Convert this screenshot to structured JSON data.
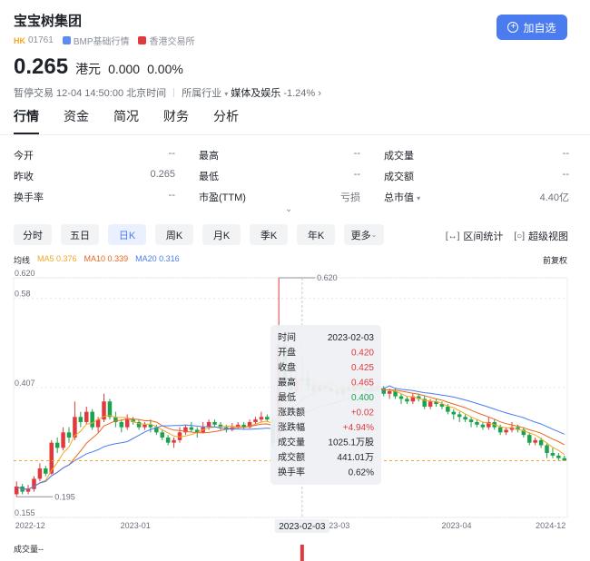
{
  "header": {
    "title": "宝宝树集团",
    "market": "HK",
    "code": "01761",
    "bmp": "BMP基础行情",
    "exchange": "香港交易所",
    "follow_label": "加自选"
  },
  "quote": {
    "price": "0.265",
    "unit": "港元",
    "change": "0.000",
    "change_pct": "0.00%",
    "status": "暂停交易 12-04 14:50:00 北京时间",
    "industry_prefix": "所属行业",
    "industry": "媒体及娱乐",
    "industry_chg": "-1.24%"
  },
  "tabs": [
    "行情",
    "资金",
    "简况",
    "财务",
    "分析"
  ],
  "stats": [
    [
      {
        "label": "今开",
        "value": "--"
      },
      {
        "label": "最高",
        "value": "--"
      },
      {
        "label": "成交量",
        "value": "--"
      }
    ],
    [
      {
        "label": "昨收",
        "value": "0.265"
      },
      {
        "label": "最低",
        "value": "--"
      },
      {
        "label": "成交额",
        "value": "--"
      }
    ],
    [
      {
        "label": "换手率",
        "value": "--"
      },
      {
        "label": "市盈(TTM)",
        "value": "亏损"
      },
      {
        "label": "总市值",
        "value": "4.40亿"
      }
    ]
  ],
  "periods": [
    "分时",
    "五日",
    "日K",
    "周K",
    "月K",
    "季K",
    "年K",
    "更多"
  ],
  "active_period": "日K",
  "tools": {
    "interval_stats": "区间统计",
    "super_view": "超级视图"
  },
  "ma": {
    "label": "均线",
    "ma5": "MA5 0.376",
    "ma10": "MA10 0.339",
    "ma20": "MA20 0.316"
  },
  "adjust": "前复权",
  "tooltip": [
    {
      "label": "时间",
      "value": "2023-02-03",
      "color": "#1f2329"
    },
    {
      "label": "开盘",
      "value": "0.420",
      "color": "#e03a3e"
    },
    {
      "label": "收盘",
      "value": "0.425",
      "color": "#e03a3e"
    },
    {
      "label": "最高",
      "value": "0.465",
      "color": "#e03a3e"
    },
    {
      "label": "最低",
      "value": "0.400",
      "color": "#1aa34a"
    },
    {
      "label": "涨跌额",
      "value": "+0.02",
      "color": "#e03a3e"
    },
    {
      "label": "涨跌幅",
      "value": "+4.94%",
      "color": "#e03a3e"
    },
    {
      "label": "成交量",
      "value": "1025.1万股",
      "color": "#1f2329"
    },
    {
      "label": "成交额",
      "value": "441.01万",
      "color": "#1f2329"
    },
    {
      "label": "换手率",
      "value": "0.62%",
      "color": "#1f2329"
    }
  ],
  "volume_label": "成交量--",
  "colors": {
    "up": "#e03a3e",
    "down": "#1aa34a",
    "ma5": "#f6a623",
    "ma10": "#e9661f",
    "ma20": "#4a7cf0",
    "accent": "#4a7cf0"
  },
  "chart_data": {
    "type": "candlestick",
    "y_ticks": [
      "0.620",
      "0.58",
      "0.407",
      "0.155"
    ],
    "x_ticks": [
      "2022-12",
      "2023-01",
      "2023-03",
      "2023-04",
      "2024-12"
    ],
    "crosshair_date": "2023-02-03",
    "max_label": "0.620",
    "min_label": "0.195",
    "last_price": 0.265,
    "ylim": [
      0.155,
      0.62
    ],
    "candles": [
      [
        0.2,
        0.215,
        0.225,
        0.195
      ],
      [
        0.215,
        0.205,
        0.22,
        0.2
      ],
      [
        0.205,
        0.21,
        0.218,
        0.2
      ],
      [
        0.21,
        0.23,
        0.235,
        0.205
      ],
      [
        0.23,
        0.25,
        0.26,
        0.225
      ],
      [
        0.25,
        0.24,
        0.255,
        0.235
      ],
      [
        0.24,
        0.3,
        0.305,
        0.238
      ],
      [
        0.3,
        0.29,
        0.31,
        0.28
      ],
      [
        0.29,
        0.32,
        0.33,
        0.285
      ],
      [
        0.32,
        0.31,
        0.33,
        0.3
      ],
      [
        0.31,
        0.35,
        0.38,
        0.305
      ],
      [
        0.35,
        0.34,
        0.36,
        0.33
      ],
      [
        0.34,
        0.36,
        0.37,
        0.335
      ],
      [
        0.36,
        0.33,
        0.365,
        0.325
      ],
      [
        0.33,
        0.345,
        0.35,
        0.32
      ],
      [
        0.345,
        0.38,
        0.395,
        0.34
      ],
      [
        0.38,
        0.35,
        0.385,
        0.345
      ],
      [
        0.35,
        0.34,
        0.36,
        0.33
      ],
      [
        0.34,
        0.33,
        0.345,
        0.32
      ],
      [
        0.33,
        0.345,
        0.355,
        0.325
      ],
      [
        0.345,
        0.34,
        0.35,
        0.335
      ],
      [
        0.34,
        0.33,
        0.345,
        0.325
      ],
      [
        0.33,
        0.335,
        0.34,
        0.325
      ],
      [
        0.335,
        0.33,
        0.345,
        0.32
      ],
      [
        0.33,
        0.32,
        0.335,
        0.315
      ],
      [
        0.32,
        0.31,
        0.325,
        0.305
      ],
      [
        0.31,
        0.3,
        0.315,
        0.295
      ],
      [
        0.3,
        0.305,
        0.31,
        0.29
      ],
      [
        0.305,
        0.32,
        0.33,
        0.3
      ],
      [
        0.32,
        0.33,
        0.335,
        0.315
      ],
      [
        0.33,
        0.325,
        0.34,
        0.32
      ],
      [
        0.325,
        0.32,
        0.33,
        0.31
      ],
      [
        0.32,
        0.33,
        0.34,
        0.318
      ],
      [
        0.33,
        0.34,
        0.345,
        0.325
      ],
      [
        0.34,
        0.335,
        0.345,
        0.33
      ],
      [
        0.335,
        0.33,
        0.34,
        0.325
      ],
      [
        0.33,
        0.325,
        0.335,
        0.32
      ],
      [
        0.325,
        0.33,
        0.338,
        0.322
      ],
      [
        0.33,
        0.335,
        0.34,
        0.328
      ],
      [
        0.335,
        0.33,
        0.34,
        0.325
      ],
      [
        0.33,
        0.34,
        0.345,
        0.328
      ],
      [
        0.34,
        0.345,
        0.35,
        0.335
      ],
      [
        0.345,
        0.35,
        0.36,
        0.34
      ],
      [
        0.35,
        0.345,
        0.355,
        0.34
      ],
      [
        0.345,
        0.3,
        0.35,
        0.29
      ],
      [
        0.3,
        0.49,
        0.62,
        0.3
      ],
      [
        0.49,
        0.42,
        0.5,
        0.41
      ],
      [
        0.42,
        0.4,
        0.45,
        0.395
      ],
      [
        0.4,
        0.42,
        0.465,
        0.395
      ],
      [
        0.42,
        0.425,
        0.465,
        0.4
      ],
      [
        0.425,
        0.41,
        0.44,
        0.4
      ],
      [
        0.41,
        0.4,
        0.42,
        0.39
      ],
      [
        0.4,
        0.41,
        0.415,
        0.395
      ],
      [
        0.41,
        0.405,
        0.415,
        0.398
      ],
      [
        0.405,
        0.4,
        0.41,
        0.395
      ],
      [
        0.4,
        0.395,
        0.405,
        0.39
      ],
      [
        0.395,
        0.405,
        0.41,
        0.39
      ],
      [
        0.405,
        0.4,
        0.42,
        0.395
      ],
      [
        0.4,
        0.41,
        0.42,
        0.398
      ],
      [
        0.41,
        0.405,
        0.415,
        0.4
      ],
      [
        0.405,
        0.4,
        0.41,
        0.395
      ],
      [
        0.4,
        0.41,
        0.425,
        0.398
      ],
      [
        0.41,
        0.405,
        0.418,
        0.398
      ],
      [
        0.405,
        0.395,
        0.41,
        0.39
      ],
      [
        0.395,
        0.4,
        0.405,
        0.385
      ],
      [
        0.4,
        0.39,
        0.405,
        0.385
      ],
      [
        0.39,
        0.385,
        0.395,
        0.375
      ],
      [
        0.385,
        0.38,
        0.39,
        0.375
      ],
      [
        0.38,
        0.39,
        0.395,
        0.375
      ],
      [
        0.39,
        0.385,
        0.395,
        0.38
      ],
      [
        0.385,
        0.37,
        0.39,
        0.365
      ],
      [
        0.37,
        0.38,
        0.385,
        0.365
      ],
      [
        0.38,
        0.375,
        0.385,
        0.37
      ],
      [
        0.375,
        0.37,
        0.38,
        0.365
      ],
      [
        0.37,
        0.36,
        0.375,
        0.355
      ],
      [
        0.36,
        0.355,
        0.365,
        0.345
      ],
      [
        0.355,
        0.35,
        0.36,
        0.34
      ],
      [
        0.35,
        0.345,
        0.355,
        0.34
      ],
      [
        0.345,
        0.34,
        0.35,
        0.33
      ],
      [
        0.34,
        0.335,
        0.345,
        0.33
      ],
      [
        0.335,
        0.33,
        0.34,
        0.325
      ],
      [
        0.33,
        0.34,
        0.35,
        0.325
      ],
      [
        0.34,
        0.33,
        0.345,
        0.325
      ],
      [
        0.33,
        0.32,
        0.335,
        0.315
      ],
      [
        0.32,
        0.325,
        0.33,
        0.315
      ],
      [
        0.325,
        0.33,
        0.34,
        0.32
      ],
      [
        0.33,
        0.325,
        0.335,
        0.32
      ],
      [
        0.325,
        0.315,
        0.33,
        0.31
      ],
      [
        0.315,
        0.3,
        0.32,
        0.295
      ],
      [
        0.3,
        0.305,
        0.31,
        0.295
      ],
      [
        0.305,
        0.295,
        0.31,
        0.29
      ],
      [
        0.295,
        0.28,
        0.3,
        0.27
      ],
      [
        0.28,
        0.275,
        0.29,
        0.27
      ],
      [
        0.275,
        0.27,
        0.28,
        0.265
      ],
      [
        0.27,
        0.265,
        0.275,
        0.265
      ]
    ]
  }
}
